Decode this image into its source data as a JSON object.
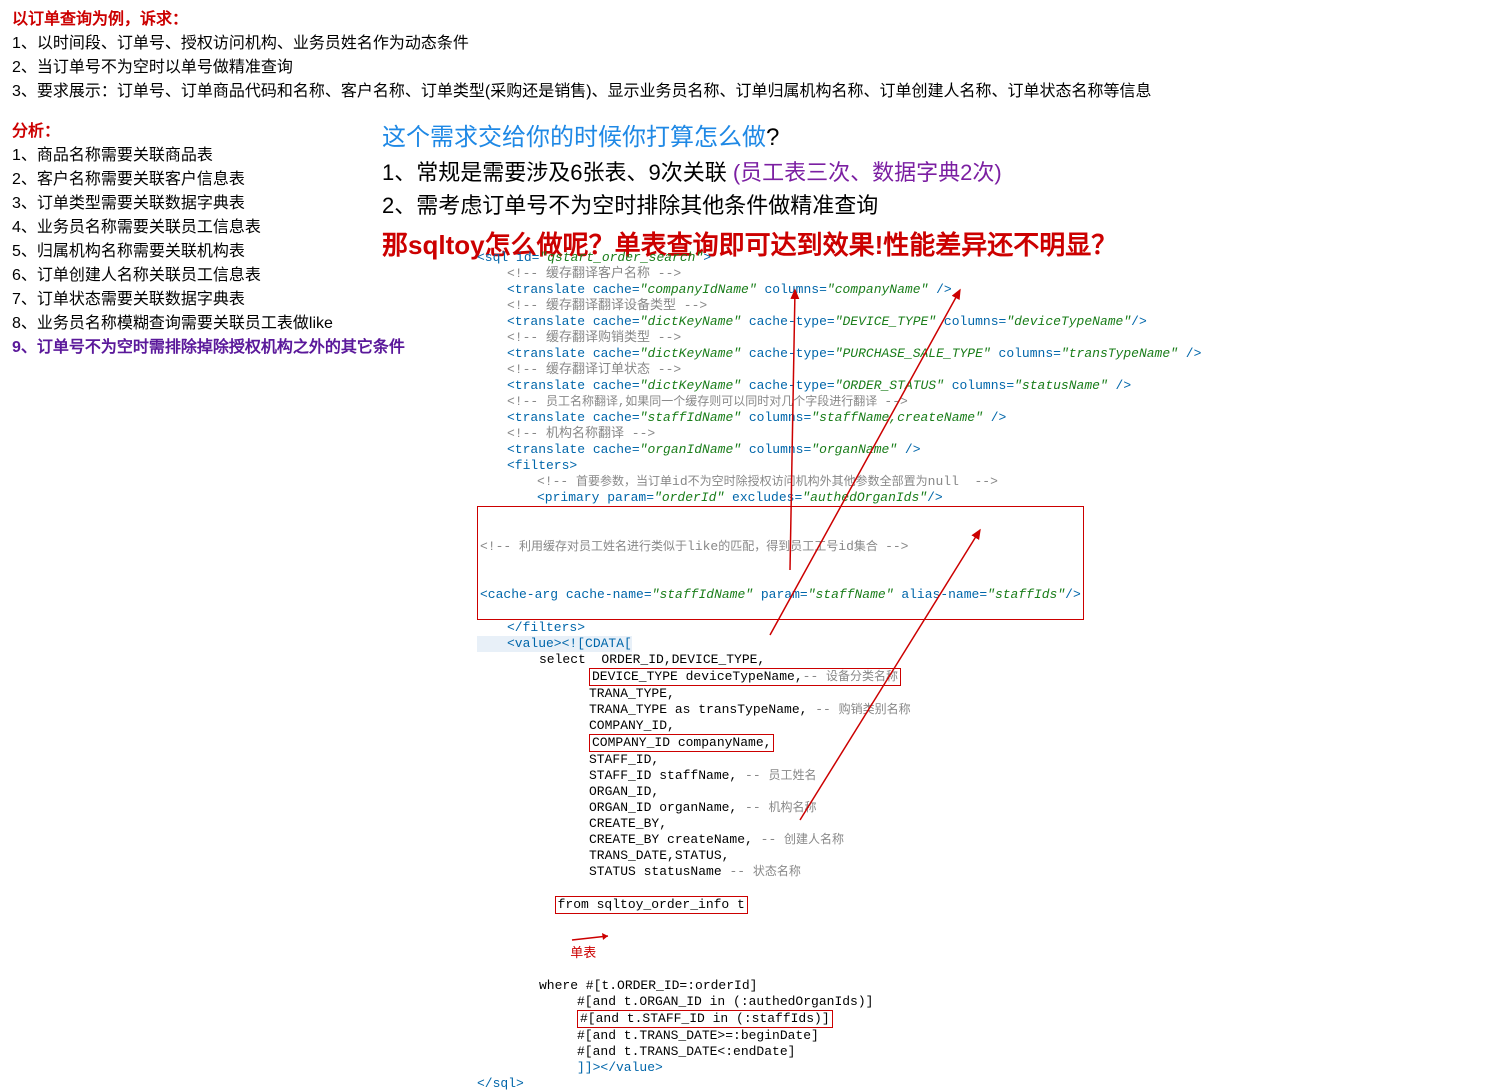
{
  "header": {
    "reqTitle": "以订单查询为例，诉求：",
    "r1": "1、以时间段、订单号、授权访问机构、业务员姓名作为动态条件",
    "r2": "2、当订单号不为空时以单号做精准查询",
    "r3": "3、要求展示：订单号、订单商品代码和名称、客户名称、订单类型(采购还是销售)、显示业务员名称、订单归属机构名称、订单创建人名称、订单状态名称等信息"
  },
  "analysis": {
    "title": "分析：",
    "a1": "1、商品名称需要关联商品表",
    "a2": "2、客户名称需要关联客户信息表",
    "a3": "3、订单类型需要关联数据字典表",
    "a4": "4、业务员名称需要关联员工信息表",
    "a5": "5、归属机构名称需要关联机构表",
    "a6": "6、订单创建人名称关联员工信息表",
    "a7": "7、订单状态需要关联数据字典表",
    "a8": "8、业务员名称模糊查询需要关联员工表做like",
    "a9": "9、订单号不为空时需排除掉除授权机构之外的其它条件"
  },
  "right": {
    "question": "这个需求交给你的时候你打算怎么做",
    "qmark": "?",
    "n1a": "1、常规是需要涉及6张表、9次关联 ",
    "n1b": "(员工表三次、数据字典2次)",
    "n2": "2、需考虑订单号不为空时排除其他条件做精准查询",
    "big": "那sqltoy怎么做呢？单表查询即可达到效果!性能差异还不明显？"
  },
  "code": {
    "l01a": "<sql ",
    "l01b": "id=",
    "l01c": "\"qstart_order_search\"",
    "l01d": ">",
    "l02": "<!-- 缓存翻译客户名称 -->",
    "l03a": "<translate ",
    "l03b": "cache=",
    "l03c": "\"companyIdName\"",
    "l03d": " columns=",
    "l03e": "\"companyName\"",
    "l03f": " />",
    "l04": "<!-- 缓存翻译翻译设备类型 -->",
    "l05a": "<translate ",
    "l05b": "cache=",
    "l05c": "\"dictKeyName\"",
    "l05d": " cache-type=",
    "l05e": "\"DEVICE_TYPE\"",
    "l05f": " columns=",
    "l05g": "\"deviceTypeName\"",
    "l05h": "/>",
    "l06": "<!-- 缓存翻译购销类型 -->",
    "l07a": "<translate ",
    "l07b": "cache=",
    "l07c": "\"dictKeyName\"",
    "l07d": " cache-type=",
    "l07e": "\"PURCHASE_SALE_TYPE\"",
    "l07f": " columns=",
    "l07g": "\"transTypeName\"",
    "l07h": " />",
    "l08": "<!-- 缓存翻译订单状态 -->",
    "l09a": "<translate ",
    "l09b": "cache=",
    "l09c": "\"dictKeyName\"",
    "l09d": " cache-type=",
    "l09e": "\"ORDER_STATUS\"",
    "l09f": " columns=",
    "l09g": "\"statusName\"",
    "l09h": " />",
    "l10a": "<!-- ",
    "l10b": "员工名称翻译,如果同一个缓存则可以同时对几个字段进行翻译 ",
    "l10c": "-->",
    "l11a": "<translate ",
    "l11b": "cache=",
    "l11c": "\"staffIdName\"",
    "l11d": " columns=",
    "l11e": "\"staffName,createName\"",
    "l11f": " />",
    "l12": "<!-- 机构名称翻译 -->",
    "l13a": "<translate ",
    "l13b": "cache=",
    "l13c": "\"organIdName\"",
    "l13d": " columns=",
    "l13e": "\"organName\"",
    "l13f": " />",
    "l14": "<filters>",
    "l15a": "<!-- ",
    "l15b": "首要参数，",
    "l15c": "当订单",
    "l15d": "id",
    "l15e": "不为空时除授权访问机构外其他参数全部置为",
    "l15f": "null  ",
    "l15g": "-->",
    "l16a": "<primary ",
    "l16b": "param=",
    "l16c": "\"orderId\"",
    "l16d": " excludes=",
    "l16e": "\"authedOrganIds\"",
    "l16f": "/>",
    "l17a": "<!-- ",
    "l17b": "利用缓存对员工姓名进行类似于",
    "l17c": "like",
    "l17d": "的匹配，得到员工工号",
    "l17e": "id",
    "l17f": "集合 ",
    "l17g": "-->",
    "l18a": "<cache-arg ",
    "l18b": "cache-name=",
    "l18c": "\"staffIdName\"",
    "l18d": " param=",
    "l18e": "\"staffName\"",
    "l18f": " alias-name=",
    "l18g": "\"staffIds\"",
    "l18h": "/>",
    "l19": "</filters>",
    "l20a": "<value>",
    "l20b": "<![CDATA[",
    "l21": "select  ORDER_ID,DEVICE_TYPE,",
    "l22a": "DEVICE_TYPE deviceTypeName,",
    "l22b": "-- ",
    "l22c": "设备分类名称",
    "l23": "TRANA_TYPE,",
    "l24a": "TRANA_TYPE as transTypeName, ",
    "l24b": "-- ",
    "l24c": "购销类别名称",
    "l25": "COMPANY_ID,",
    "l26": "COMPANY_ID companyName,",
    "l27": "STAFF_ID,",
    "l28a": "STAFF_ID staffName, ",
    "l28b": "-- ",
    "l28c": "员工姓名",
    "l29": "ORGAN_ID,",
    "l30a": "ORGAN_ID organName, ",
    "l30b": "-- ",
    "l30c": "机构名称",
    "l31": "CREATE_BY,",
    "l32a": "CREATE_BY createName, ",
    "l32b": "-- ",
    "l32c": "创建人名称",
    "l33": "TRANS_DATE,STATUS,",
    "l34a": "STATUS statusName ",
    "l34b": "-- ",
    "l34c": "状态名称",
    "l35": "from sqltoy_order_info t",
    "l35arrow": "单表",
    "l36": "where #[t.ORDER_ID=:orderId]",
    "l37": "#[and t.ORGAN_ID in (:authedOrganIds)]",
    "l38": "#[and t.STAFF_ID in (:staffIds)]",
    "l39": "#[and t.TRANS_DATE>=:beginDate]",
    "l40": "#[and t.TRANS_DATE<:endDate]",
    "l41": "]]></value>",
    "l42": "</sql>"
  }
}
